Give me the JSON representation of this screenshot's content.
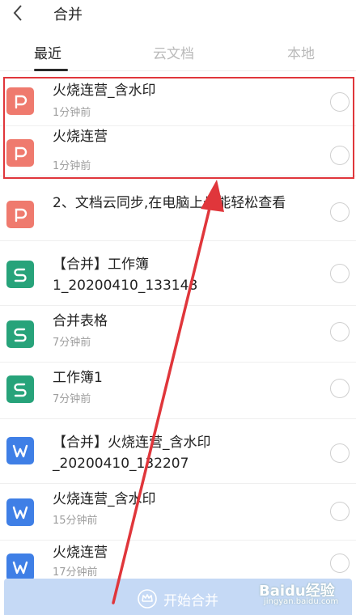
{
  "header": {
    "title": "合并"
  },
  "tabs": [
    {
      "label": "最近",
      "active": true
    },
    {
      "label": "云文档",
      "active": false
    },
    {
      "label": "本地",
      "active": false
    }
  ],
  "files": [
    {
      "icon": "presentation-icon",
      "name": "火烧连营_含水印",
      "time": "1分钟前"
    },
    {
      "icon": "presentation-icon",
      "name": "火烧连营",
      "time": "1分钟前"
    },
    {
      "icon": "presentation-icon",
      "name": "2、文档云同步,在电脑上也能轻松查看",
      "time": ""
    },
    {
      "icon": "spreadsheet-icon",
      "name": "【合并】工作簿1_20200410_133148",
      "time": ""
    },
    {
      "icon": "spreadsheet-icon",
      "name": "合并表格",
      "time": "7分钟前"
    },
    {
      "icon": "spreadsheet-icon",
      "name": "工作簿1",
      "time": "7分钟前"
    },
    {
      "icon": "word-doc-icon",
      "name": "【合并】火烧连营_含水印_20200410_132207",
      "time": ""
    },
    {
      "icon": "word-doc-icon",
      "name": "火烧连营_含水印",
      "time": "15分钟前"
    },
    {
      "icon": "word-doc-icon",
      "name": "火烧连营",
      "time": "17分钟前"
    }
  ],
  "bottom": {
    "merge_label": "开始合并"
  },
  "watermark": {
    "main": "Baidu经验",
    "sub": "jingyan.baidu.com"
  },
  "colors": {
    "presentation": "#ef7a6e",
    "spreadsheet": "#27a37a",
    "word": "#3f7fe6",
    "highlight": "#e0363b",
    "merge_button": "#c5d9f5"
  }
}
